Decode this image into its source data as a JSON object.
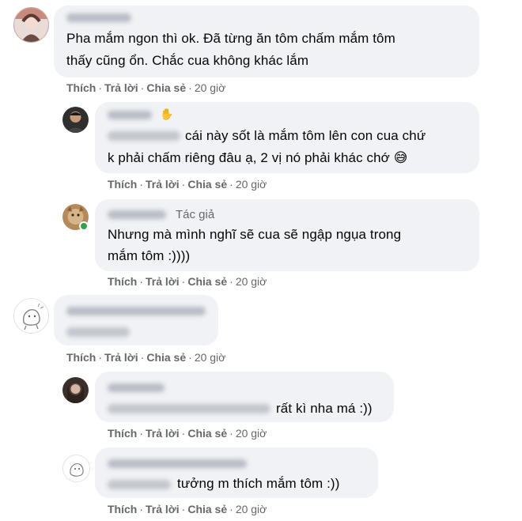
{
  "actions": {
    "like": "Thích",
    "reply": "Trả lời",
    "share": "Chia sẻ",
    "dot": "·"
  },
  "comments": [
    {
      "line1": "Pha mắm ngon thì ok. Đã từng ăn tôm chấm mắm tôm",
      "line2": "thấy cũng ổn. Chắc cua không khác lắm",
      "time": "20 giờ"
    },
    {
      "badge_icon": "wave-hand-icon",
      "badge": "✋",
      "line1": "cái này sốt là mắm tôm lên con cua chứ",
      "line2": "k phải chấm riêng đâu ạ, 2 vị nó phải khác chớ",
      "emoji": "😅",
      "time": "20 giờ"
    },
    {
      "author_label": "Tác giả",
      "line1": "Nhưng mà mình nghĩ sẽ cua sẽ ngập ngụa trong",
      "line2": "mắm tôm :))))",
      "time": "20 giờ"
    },
    {
      "time": "20 giờ"
    },
    {
      "line1": "rất kì nha má :))",
      "time": "20 giờ"
    },
    {
      "line1": "tưởng m thích mắm tôm :))",
      "time": "20 giờ"
    }
  ],
  "colors": {
    "bubble": "#f0f2f5",
    "meta": "#65676b",
    "online": "#31a24c"
  }
}
